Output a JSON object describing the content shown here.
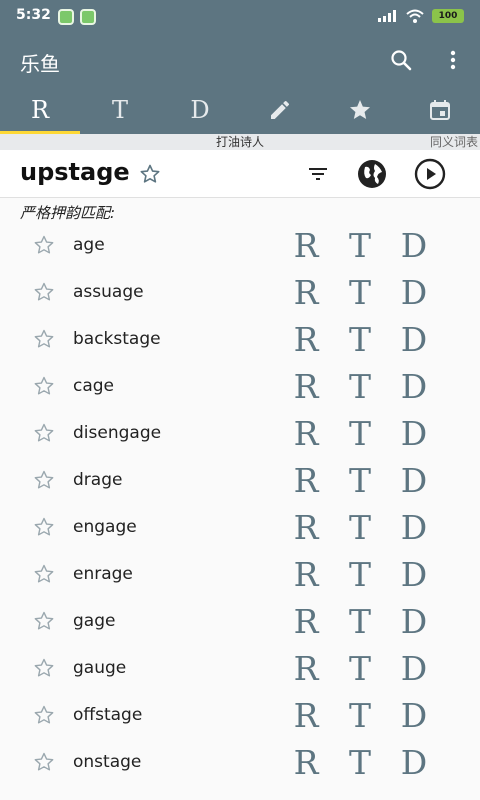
{
  "status": {
    "time": "5:32",
    "battery": "100"
  },
  "app": {
    "title": "乐鱼"
  },
  "tabs": [
    {
      "label": "R",
      "icon": "rhyme-tab"
    },
    {
      "label": "T",
      "icon": "thesaurus-tab"
    },
    {
      "label": "D",
      "icon": "dictionary-tab"
    },
    {
      "label": "",
      "icon": "pencil-icon"
    },
    {
      "label": "",
      "icon": "star-icon"
    },
    {
      "label": "",
      "icon": "calendar-icon"
    }
  ],
  "subtitle": {
    "center": "打油诗人",
    "right": "同义词表"
  },
  "word": {
    "title": "upstage"
  },
  "section": {
    "label": "严格押韵匹配:"
  },
  "rows": [
    {
      "word": "age"
    },
    {
      "word": "assuage"
    },
    {
      "word": "backstage"
    },
    {
      "word": "cage"
    },
    {
      "word": "disengage"
    },
    {
      "word": "drage"
    },
    {
      "word": "engage"
    },
    {
      "word": "enrage"
    },
    {
      "word": "gage"
    },
    {
      "word": "gauge"
    },
    {
      "word": "offstage"
    },
    {
      "word": "onstage"
    }
  ],
  "row_actions": {
    "r": "R",
    "t": "T",
    "d": "D"
  },
  "colors": {
    "primary": "#5d7581",
    "accent": "#fdd835",
    "background": "#fafafa"
  }
}
